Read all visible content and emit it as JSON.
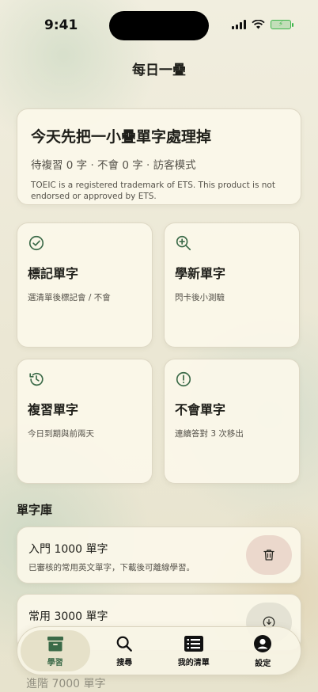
{
  "status": {
    "time": "9:41",
    "battery_glyph": "⚡"
  },
  "header": {
    "title": "每日一疊"
  },
  "hero": {
    "title": "今天先把一小疊單字處理掉",
    "summary": "待複習 0 字 · 不會 0 字 · 訪客模式",
    "trademark": "TOEIC is a registered trademark of ETS. This product is not endorsed or approved by ETS."
  },
  "tiles": [
    {
      "icon": "check-circle-icon",
      "title": "標記單字",
      "desc": "選清單後標記會 / 不會"
    },
    {
      "icon": "zoom-in-icon",
      "title": "學新單字",
      "desc": "閃卡後小測驗"
    },
    {
      "icon": "history-icon",
      "title": "複習單字",
      "desc": "今日到期與前兩天"
    },
    {
      "icon": "alert-circle-icon",
      "title": "不會單字",
      "desc": "連續答對 3 次移出"
    }
  ],
  "library": {
    "heading": "單字庫",
    "items": [
      {
        "name": "入門 1000 單字",
        "desc": "已審核的常用英文單字，下載後可離線學習。",
        "action_icon": "trash-icon"
      },
      {
        "name": "常用 3000 單字",
        "desc": "",
        "action_icon": "download-icon"
      },
      {
        "name": "進階 7000 單字"
      }
    ]
  },
  "tabbar": {
    "tabs": [
      {
        "label": "學習",
        "icon": "archive-box-icon",
        "active": true
      },
      {
        "label": "搜尋",
        "icon": "search-icon",
        "active": false
      },
      {
        "label": "我的清單",
        "icon": "list-icon",
        "active": false
      },
      {
        "label": "設定",
        "icon": "user-icon",
        "active": false
      }
    ]
  },
  "colors": {
    "accent": "#3b6a48",
    "background": "#ece8d6",
    "card": "#fbf8ea"
  }
}
